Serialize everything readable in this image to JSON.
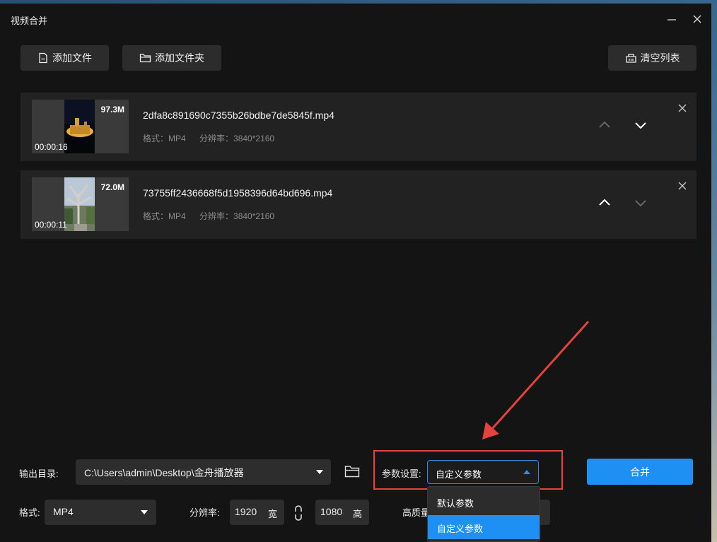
{
  "window": {
    "title": "视频合并"
  },
  "toolbar": {
    "add_file": "添加文件",
    "add_folder": "添加文件夹",
    "clear_list": "清空列表"
  },
  "files": [
    {
      "name": "2dfa8c891690c7355b26bdbe7de5845f.mp4",
      "format": "格式：MP4",
      "resolution": "分辨率：3840*2160",
      "size": "97.3M",
      "duration": "00:00:16"
    },
    {
      "name": "73755ff2436668f5d1958396d64bd696.mp4",
      "format": "格式：MP4",
      "resolution": "分辨率：3840*2160",
      "size": "72.0M",
      "duration": "00:00:11"
    }
  ],
  "settings": {
    "output_dir_label": "输出目录:",
    "output_dir_value": "C:\\Users\\admin\\Desktop\\金舟播放器",
    "param_label": "参数设置:",
    "param_value": "自定义参数",
    "param_options": [
      "默认参数",
      "自定义参数"
    ],
    "format_label": "格式:",
    "format_value": "MP4",
    "resolution_label": "分辨率:",
    "width_value": "1920",
    "width_unit": "宽",
    "height_value": "1080",
    "height_unit": "高",
    "quality_label": "高质量"
  },
  "merge_button": "合并",
  "colors": {
    "accent": "#1e90f4",
    "annotation": "#e4423c",
    "background": "#141414",
    "item_bg": "#222222"
  }
}
